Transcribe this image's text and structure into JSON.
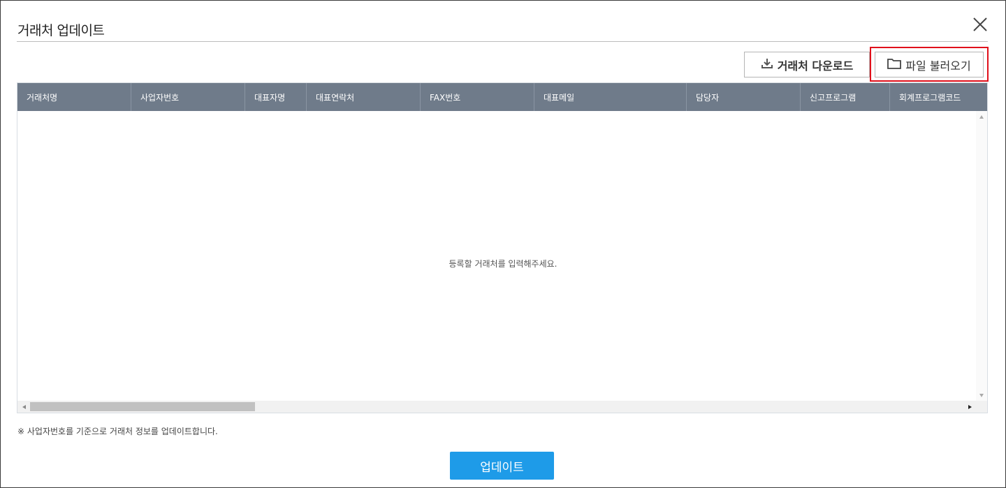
{
  "dialog": {
    "title": "거래처 업데이트",
    "close_icon": "close-icon"
  },
  "toolbar": {
    "download_label": "거래처 다운로드",
    "download_icon": "download-icon",
    "load_file_label": "파일 불러오기",
    "load_file_icon": "folder-icon",
    "highlight_color": "#e0101b"
  },
  "grid": {
    "columns": [
      "거래처명",
      "사업자번호",
      "대표자명",
      "대표연락처",
      "FAX번호",
      "대표메일",
      "담당자",
      "신고프로그램",
      "회계프로그램코드"
    ],
    "rows": [],
    "empty_message": "등록할 거래처를 입력해주세요.",
    "header_color": "#6f7b8a"
  },
  "footer": {
    "note": "※ 사업자번호를 기준으로 거래처 정보를 업데이트합니다.",
    "update_label": "업데이트",
    "update_color": "#1e9be8"
  }
}
